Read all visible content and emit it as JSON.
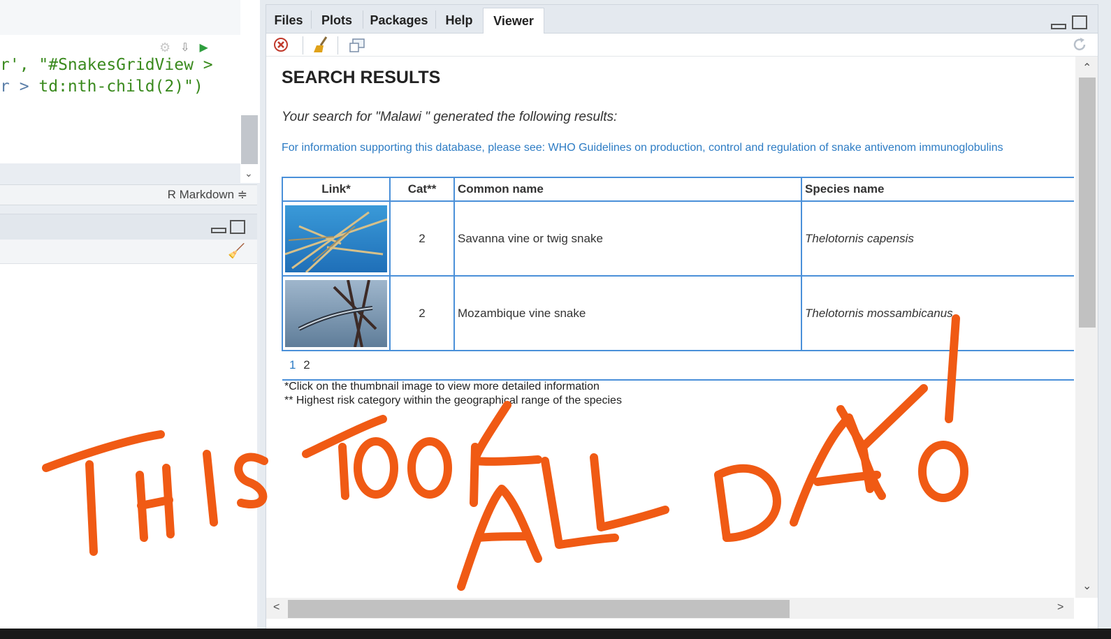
{
  "editor": {
    "code_line_1": [
      {
        "t": "r', ",
        "c": "str"
      },
      {
        "t": "\"#SnakesGridView >",
        "c": "str"
      }
    ],
    "code_line_2": [
      {
        "t": "r > ",
        "c": "op"
      },
      {
        "t": "td:nth-child(2)\")",
        "c": "str"
      }
    ],
    "doc_type": "R Markdown ≑"
  },
  "viewer_pane": {
    "tabs": [
      "Files",
      "Plots",
      "Packages",
      "Help",
      "Viewer"
    ],
    "active_tab": "Viewer"
  },
  "page": {
    "heading": "SEARCH RESULTS",
    "summary": "Your search for \"Malawi \" generated the following results:",
    "info_link": "For information supporting this database, please see: WHO Guidelines on production, control and regulation of snake antivenom immunoglobulins",
    "table": {
      "headers": [
        "Link*",
        "Cat**",
        "Common name",
        "Species name"
      ],
      "rows": [
        {
          "cat": "2",
          "common": "Savanna vine or twig snake",
          "species": "Thelotornis capensis"
        },
        {
          "cat": "2",
          "common": "Mozambique vine snake",
          "species": "Thelotornis mossambicanus"
        }
      ],
      "pages": [
        "1",
        "2"
      ]
    },
    "footnote_1": "*Click on the thumbnail image to view more detailed information",
    "footnote_2": "** Highest risk category within the geographical range of the species"
  },
  "annotation": {
    "text": "THIS TOOK ALL DAY!",
    "color": "#f05a14"
  },
  "colors": {
    "link_blue": "#2d7cc4",
    "table_border": "#4a90d9"
  }
}
